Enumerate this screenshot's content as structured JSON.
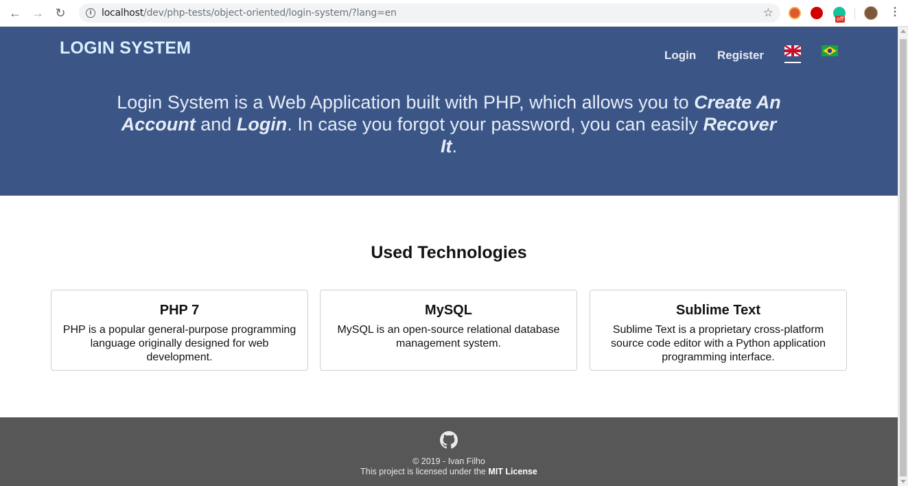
{
  "browser": {
    "url_host": "localhost",
    "url_path": "/dev/php-tests/object-oriented/login-system/?lang=en",
    "ext3_badge": "off"
  },
  "header": {
    "brand": "LOGIN SYSTEM",
    "nav": {
      "login": "Login",
      "register": "Register"
    }
  },
  "hero": {
    "t1": "Login System is a Web Application built with PHP, which allows you to ",
    "b1": "Create An Account",
    "t2": " and ",
    "b2": "Login",
    "t3": ". In case you forgot your password, you can easily ",
    "b3": "Recover It",
    "t4": "."
  },
  "technologies": {
    "title": "Used Technologies",
    "cards": [
      {
        "name": "PHP 7",
        "desc": "PHP is a popular general-purpose programming language originally designed for web development."
      },
      {
        "name": "MySQL",
        "desc": "MySQL is an open-source relational database management system."
      },
      {
        "name": "Sublime Text",
        "desc": "Sublime Text is a proprietary cross-platform source code editor with a Python application programming interface."
      }
    ]
  },
  "footer": {
    "copyright": "© 2019 - Ivan Filho",
    "license_prefix": "This project is licensed under the ",
    "license_link": "MIT License"
  },
  "colors": {
    "hero_bg": "#3b5586",
    "footer_bg": "#575757"
  }
}
